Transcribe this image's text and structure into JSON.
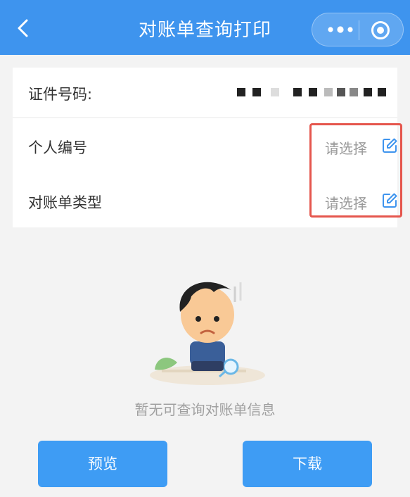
{
  "header": {
    "title": "对账单查询打印",
    "back_icon": "chevron-left-icon",
    "more_icon": "more-dots-icon",
    "close_icon": "target-circle-icon",
    "color": "#3e94ee"
  },
  "identity": {
    "label": "证件号码:"
  },
  "form": {
    "rows": [
      {
        "label": "个人编号",
        "value": "请选择",
        "icon": "edit-icon"
      },
      {
        "label": "对账单类型",
        "value": "请选择",
        "icon": "edit-icon"
      }
    ],
    "highlight_color": "#e5564d"
  },
  "empty_state": {
    "message": "暂无可查询对账单信息"
  },
  "actions": {
    "preview_label": "预览",
    "download_label": "下载",
    "button_color": "#3e9cf4"
  }
}
